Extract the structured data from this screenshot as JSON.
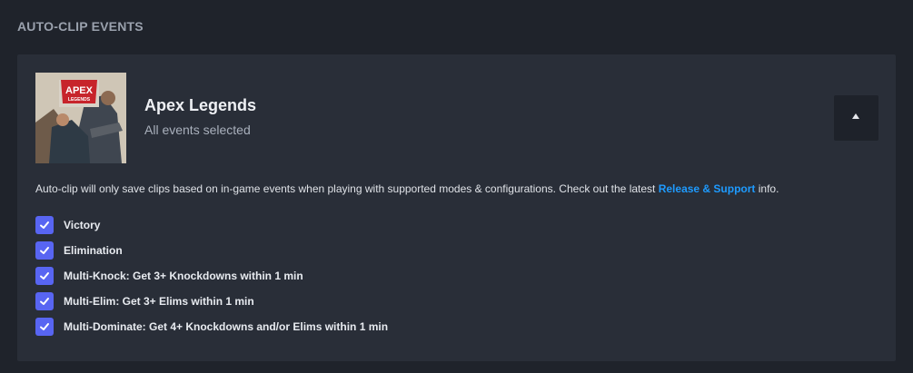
{
  "section": {
    "title": "AUTO-CLIP EVENTS"
  },
  "game": {
    "logo_text": "APEX",
    "logo_subtext": "LEGENDS",
    "name": "Apex Legends",
    "subtitle": "All events selected"
  },
  "description": {
    "text_before": "Auto-clip will only save clips based on in-game events when playing with supported modes & configurations. Check out the latest ",
    "link": "Release & Support",
    "text_after": " info."
  },
  "events": [
    {
      "label": "Victory",
      "checked": true
    },
    {
      "label": "Elimination",
      "checked": true
    },
    {
      "label": "Multi-Knock: Get 3+ Knockdowns within 1 min",
      "checked": true
    },
    {
      "label": "Multi-Elim: Get 3+ Elims within 1 min",
      "checked": true
    },
    {
      "label": "Multi-Dominate: Get 4+ Knockdowns and/or Elims within 1 min",
      "checked": true
    }
  ],
  "colors": {
    "background": "#1f232b",
    "card": "#292e38",
    "accent": "#5865f2",
    "link": "#1e9bff"
  },
  "icons": {
    "collapse": "chevron-up-icon",
    "check": "check-icon"
  }
}
